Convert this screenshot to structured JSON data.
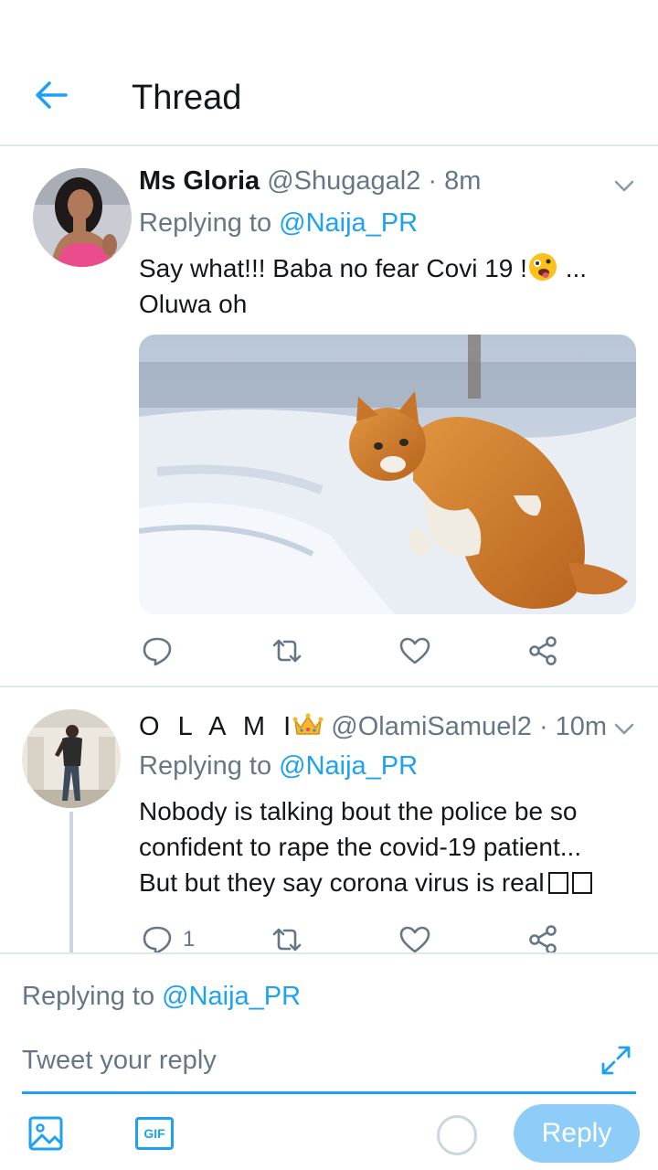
{
  "header": {
    "title": "Thread"
  },
  "tweets": [
    {
      "name": "Ms Gloria",
      "handle": "@Shugagal2",
      "time": "· 8m",
      "replying_prefix": "Replying to",
      "replying_handle": "@Naija_PR",
      "text_line1": "Say what!!! Baba no fear Covi 19 !",
      "text_line1_tail": " ...",
      "text_line2": "Oluwa oh",
      "media": "cat-in-snow-photo"
    },
    {
      "name": "O L A M I",
      "handle": "@OlamiSamuel2",
      "time": "· 10m",
      "replying_prefix": "Replying to",
      "replying_handle": "@Naija_PR",
      "text_line1": "Nobody is talking bout the police be so",
      "text_line2": "confident to rape the covid-19 patient...",
      "text_line3": "But but they say corona virus is real",
      "reply_count": "1"
    }
  ],
  "composer": {
    "replying_prefix": "Replying to",
    "replying_handle": "@Naija_PR",
    "placeholder": "Tweet your reply",
    "gif_label": "GIF",
    "reply_label": "Reply"
  },
  "colors": {
    "accent": "#1da1f2",
    "muted": "#657786",
    "reply_button": "#8ecdf8"
  }
}
